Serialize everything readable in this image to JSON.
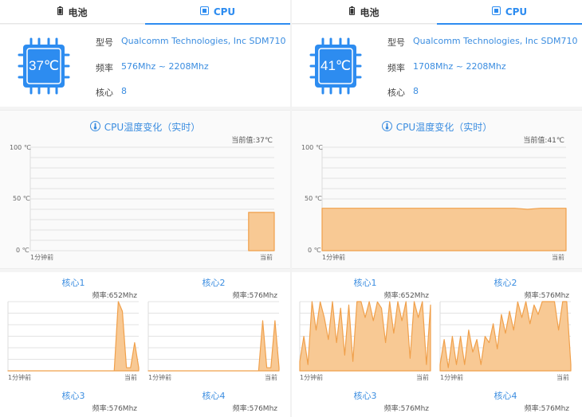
{
  "colors": {
    "accent": "#2d8cf0",
    "fill": "#f8c994",
    "stroke": "#f0a04b"
  },
  "panels": [
    {
      "tabs": {
        "battery": "电池",
        "cpu": "CPU"
      },
      "chip_temp": "37℃",
      "info": [
        {
          "key": "型号",
          "value": "Qualcomm Technologies, Inc SDM710"
        },
        {
          "key": "频率",
          "value": "576Mhz ~ 2208Mhz"
        },
        {
          "key": "核心",
          "value": "8"
        }
      ],
      "temp_chart": {
        "title": "CPU温度变化（实时）",
        "current": "当前值:37℃",
        "y_ticks": [
          "100 ℃",
          "50 ℃",
          "0 ℃"
        ],
        "x_start": "1分钟前",
        "x_end": "当前"
      },
      "cores": [
        {
          "title": "核心1",
          "freq": "频率:652Mhz",
          "x_start": "1分钟前",
          "x_end": "当前"
        },
        {
          "title": "核心2",
          "freq": "频率:576Mhz",
          "x_start": "1分钟前",
          "x_end": "当前"
        },
        {
          "title": "核心3",
          "freq": "频率:576Mhz"
        },
        {
          "title": "核心4",
          "freq": "频率:576Mhz"
        }
      ]
    },
    {
      "tabs": {
        "battery": "电池",
        "cpu": "CPU"
      },
      "chip_temp": "41℃",
      "info": [
        {
          "key": "型号",
          "value": "Qualcomm Technologies, Inc SDM710"
        },
        {
          "key": "频率",
          "value": "1708Mhz ~ 2208Mhz"
        },
        {
          "key": "核心",
          "value": "8"
        }
      ],
      "temp_chart": {
        "title": "CPU温度变化（实时）",
        "current": "当前值:41℃",
        "y_ticks": [
          "100 ℃",
          "50 ℃",
          "0 ℃"
        ],
        "x_start": "1分钟前",
        "x_end": "当前"
      },
      "cores": [
        {
          "title": "核心1",
          "freq": "频率:652Mhz",
          "x_start": "1分钟前",
          "x_end": "当前"
        },
        {
          "title": "核心2",
          "freq": "频率:576Mhz",
          "x_start": "1分钟前",
          "x_end": "当前"
        },
        {
          "title": "核心3",
          "freq": "频率:576Mhz"
        },
        {
          "title": "核心4",
          "freq": "频率:576Mhz"
        }
      ]
    }
  ],
  "chart_data": [
    {
      "type": "area",
      "title": "CPU温度变化（实时）",
      "ylim": [
        0,
        100
      ],
      "x": [
        "1分钟前",
        "当前"
      ],
      "values": [
        null,
        null,
        null,
        null,
        null,
        null,
        null,
        null,
        null,
        null,
        null,
        null,
        null,
        null,
        null,
        null,
        null,
        37,
        37,
        37
      ]
    },
    {
      "type": "area",
      "title": "核心1",
      "ylim": [
        0,
        2208
      ],
      "values": [
        0,
        0,
        0,
        0,
        0,
        0,
        0,
        0,
        0,
        0,
        0,
        0,
        0,
        0,
        0,
        0,
        0,
        0,
        0,
        0,
        0,
        0,
        0,
        0,
        0,
        0,
        0,
        2208,
        1900,
        100,
        100,
        900,
        100
      ]
    },
    {
      "type": "area",
      "title": "核心2",
      "ylim": [
        0,
        2208
      ],
      "values": [
        0,
        0,
        0,
        0,
        0,
        0,
        0,
        0,
        0,
        0,
        0,
        0,
        0,
        0,
        0,
        0,
        0,
        0,
        0,
        0,
        0,
        0,
        0,
        0,
        0,
        0,
        0,
        0,
        1600,
        100,
        100,
        1600,
        100
      ]
    },
    {
      "type": "area",
      "title": "CPU温度变化（实时）",
      "ylim": [
        0,
        100
      ],
      "x": [
        "1分钟前",
        "当前"
      ],
      "values": [
        41,
        41,
        41,
        41,
        41,
        41,
        41,
        41,
        41,
        41,
        41,
        41,
        41,
        41,
        41,
        41,
        40,
        41,
        41,
        41
      ]
    },
    {
      "type": "area",
      "title": "核心1",
      "ylim": [
        0,
        2208
      ],
      "values": [
        300,
        1100,
        200,
        2208,
        1300,
        2200,
        1700,
        1000,
        2208,
        900,
        2000,
        500,
        2100,
        300,
        2208,
        2208,
        1700,
        2208,
        1600,
        2200,
        2000,
        900,
        2208,
        1200,
        2208,
        1600,
        2208,
        400,
        2208,
        1700,
        2208,
        200,
        2100
      ]
    },
    {
      "type": "area",
      "title": "核心2",
      "ylim": [
        0,
        2208
      ],
      "values": [
        200,
        1000,
        100,
        1100,
        200,
        1100,
        200,
        1300,
        600,
        1000,
        200,
        1100,
        900,
        1500,
        700,
        1800,
        1200,
        1900,
        1300,
        2200,
        1700,
        2208,
        1500,
        2100,
        1800,
        2208,
        2208,
        2208,
        2208,
        1300,
        2208,
        2208,
        200
      ]
    }
  ]
}
